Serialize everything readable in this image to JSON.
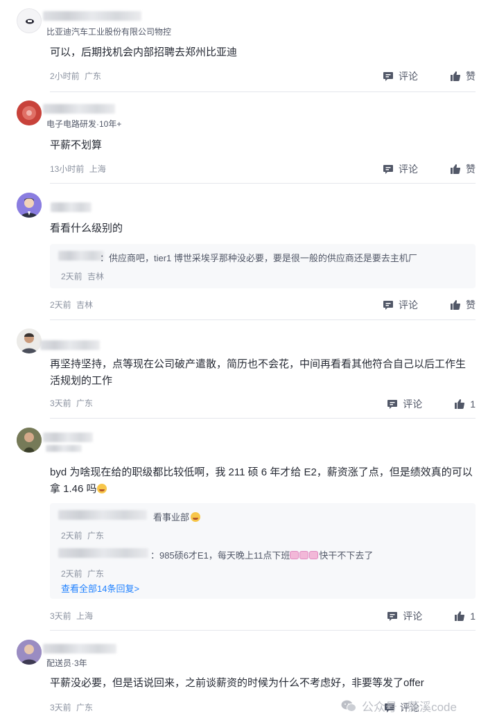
{
  "comments": [
    {
      "tagline": "比亚迪汽车工业股份有限公司物控",
      "text": "可以，后期找机会内部招聘去郑州比亚迪",
      "time": "2小时前",
      "location": "广东",
      "reply_label": "评论",
      "like_label": "赞"
    },
    {
      "tagline": "电子电路研发·10年+",
      "text": "平薪不划算",
      "time": "13小时前",
      "location": "上海",
      "reply_label": "评论",
      "like_label": "赞"
    },
    {
      "tagline": "",
      "text": "看看什么级别的",
      "time": "2天前",
      "location": "吉林",
      "reply_label": "评论",
      "like_label": "赞",
      "replies": [
        {
          "text": "：供应商吧，tier1 博世采埃孚那种没必要，要是很一般的供应商还是要去主机厂",
          "time": "2天前",
          "location": "吉林"
        }
      ]
    },
    {
      "tagline": "",
      "text": "再坚持坚持，点等现在公司破产遣散，简历也不会花，中间再看看其他符合自己以后工作生活规划的工作",
      "time": "3天前",
      "location": "广东",
      "reply_label": "评论",
      "like_label": "1"
    },
    {
      "tagline": "",
      "text": "byd 为啥现在给的职级都比较低啊，我 211 硕 6 年才给 E2，薪资涨了点，但是绩效真的可以拿 1.46 吗",
      "time": "3天前",
      "location": "上海",
      "reply_label": "评论",
      "like_label": "1",
      "replies": [
        {
          "text": "看事业部",
          "time": "2天前",
          "location": "广东"
        },
        {
          "text": "：985硕6才E1，每天晚上11点下班",
          "text_after": "快干不下去了",
          "time": "2天前",
          "location": "广东"
        }
      ],
      "view_all": "查看全部14条回复>"
    },
    {
      "tagline": "配送员·3年",
      "text": "平薪没必要，但是话说回来，之前谈薪资的时候为什么不考虑好，非要等发了offer",
      "time": "3天前",
      "location": "广东",
      "reply_label": "评论",
      "like_label": ""
    }
  ],
  "watermark": "公众号 · 藻溪code",
  "colors": {
    "link": "#1e80ff",
    "meta": "#8a919f",
    "text": "#252933",
    "reply_bg": "#f7f8fa"
  }
}
